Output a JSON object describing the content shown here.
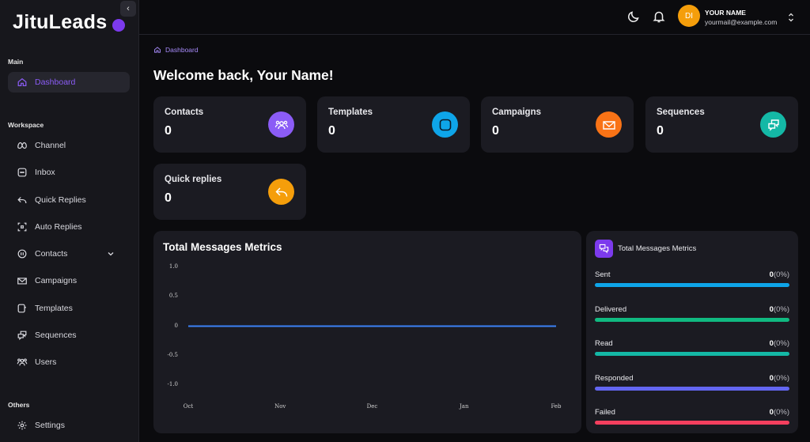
{
  "app": {
    "logo": "JituLeads"
  },
  "sidebar": {
    "section_main": "Main",
    "section_workspace": "Workspace",
    "section_others": "Others",
    "items": [
      {
        "label": "Dashboard",
        "icon": "home-icon"
      },
      {
        "label": "Channel",
        "icon": "meta-icon"
      },
      {
        "label": "Inbox",
        "icon": "chat-icon"
      },
      {
        "label": "Quick Replies",
        "icon": "reply-icon"
      },
      {
        "label": "Auto Replies",
        "icon": "auto-reply-icon"
      },
      {
        "label": "Contacts",
        "icon": "contacts-icon"
      },
      {
        "label": "Campaigns",
        "icon": "campaign-icon"
      },
      {
        "label": "Templates",
        "icon": "template-icon"
      },
      {
        "label": "Sequences",
        "icon": "sequence-icon"
      },
      {
        "label": "Users",
        "icon": "users-icon"
      },
      {
        "label": "Settings",
        "icon": "gear-icon"
      }
    ]
  },
  "header": {
    "user_initials": "DI",
    "user_name": "YOUR NAME",
    "user_email": "yourmail@example.com"
  },
  "breadcrumb": "Dashboard",
  "welcome": "Welcome back, Your Name!",
  "stats": [
    {
      "title": "Contacts",
      "value": "0",
      "color": "#8b5cf6"
    },
    {
      "title": "Templates",
      "value": "0",
      "color": "#0ea5e9"
    },
    {
      "title": "Campaigns",
      "value": "0",
      "color": "#f97316"
    },
    {
      "title": "Sequences",
      "value": "0",
      "color": "#14b8a6"
    },
    {
      "title": "Quick replies",
      "value": "0",
      "color": "#f59e0b"
    }
  ],
  "chart_title": "Total Messages Metrics",
  "chart_data": {
    "type": "line",
    "title": "Total Messages Metrics",
    "categories": [
      "Oct",
      "Nov",
      "Dec",
      "Jan",
      "Feb"
    ],
    "series": [
      {
        "values": [
          0,
          0,
          0,
          0,
          0
        ],
        "color": "#3b82f6"
      }
    ],
    "yticks": [
      "1.0",
      "0.5",
      "0",
      "-0.5",
      "-1.0"
    ],
    "ylim": [
      -1.0,
      1.0
    ]
  },
  "metrics_panel": {
    "title": "Total Messages Metrics",
    "items": [
      {
        "label": "Sent",
        "count": "0",
        "pct": "(0%)",
        "color": "#0ea5e9"
      },
      {
        "label": "Delivered",
        "count": "0",
        "pct": "(0%)",
        "color": "#10b981"
      },
      {
        "label": "Read",
        "count": "0",
        "pct": "(0%)",
        "color": "#14b8a6"
      },
      {
        "label": "Responded",
        "count": "0",
        "pct": "(0%)",
        "color": "#6366f1"
      },
      {
        "label": "Failed",
        "count": "0",
        "pct": "(0%)",
        "color": "#f43f5e"
      }
    ]
  }
}
